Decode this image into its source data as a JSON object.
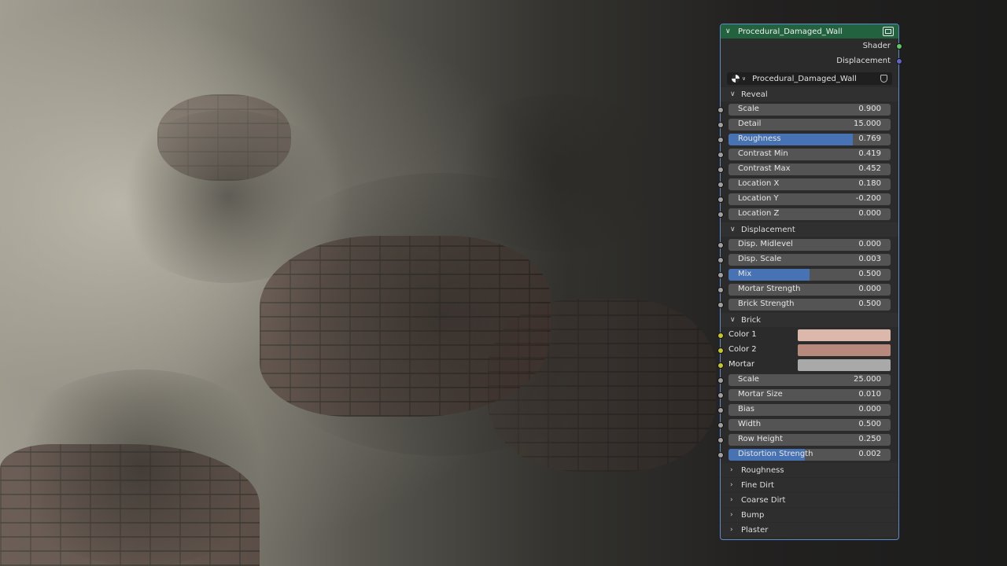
{
  "node": {
    "title": "Procedural_Damaged_Wall",
    "outputs": [
      "Shader",
      "Displacement"
    ],
    "group_name": "Procedural_Damaged_Wall",
    "accent_color": "#22623f",
    "selection_color": "#5b8bc8"
  },
  "panels": {
    "reveal": {
      "title": "Reveal",
      "fields": [
        {
          "label": "Scale",
          "value": "0.900",
          "fill": 0
        },
        {
          "label": "Detail",
          "value": "15.000",
          "fill": 0
        },
        {
          "label": "Roughness",
          "value": "0.769",
          "fill": 0.769
        },
        {
          "label": "Contrast Min",
          "value": "0.419",
          "fill": 0
        },
        {
          "label": "Contrast Max",
          "value": "0.452",
          "fill": 0
        },
        {
          "label": "Location X",
          "value": "0.180",
          "fill": 0
        },
        {
          "label": "Location Y",
          "value": "-0.200",
          "fill": 0
        },
        {
          "label": "Location Z",
          "value": "0.000",
          "fill": 0
        }
      ]
    },
    "displacement": {
      "title": "Displacement",
      "fields": [
        {
          "label": "Disp. Midlevel",
          "value": "0.000",
          "fill": 0
        },
        {
          "label": "Disp. Scale",
          "value": "0.003",
          "fill": 0
        },
        {
          "label": "Mix",
          "value": "0.500",
          "fill": 0.5
        },
        {
          "label": "Mortar Strength",
          "value": "0.000",
          "fill": 0
        },
        {
          "label": "Brick Strength",
          "value": "0.500",
          "fill": 0
        }
      ]
    },
    "brick": {
      "title": "Brick",
      "colors": [
        {
          "label": "Color 1",
          "color": "#dbb7ac"
        },
        {
          "label": "Color 2",
          "color": "#b7887c"
        },
        {
          "label": "Mortar",
          "color": "#a9a9a9"
        }
      ],
      "fields": [
        {
          "label": "Scale",
          "value": "25.000",
          "fill": 0
        },
        {
          "label": "Mortar Size",
          "value": "0.010",
          "fill": 0
        },
        {
          "label": "Bias",
          "value": "0.000",
          "fill": 0
        },
        {
          "label": "Width",
          "value": "0.500",
          "fill": 0
        },
        {
          "label": "Row Height",
          "value": "0.250",
          "fill": 0
        },
        {
          "label": "Distortion Strength",
          "value": "0.002",
          "fill": 0.47
        }
      ]
    },
    "collapsed": [
      "Roughness",
      "Fine Dirt",
      "Coarse Dirt",
      "Bump",
      "Plaster"
    ]
  }
}
